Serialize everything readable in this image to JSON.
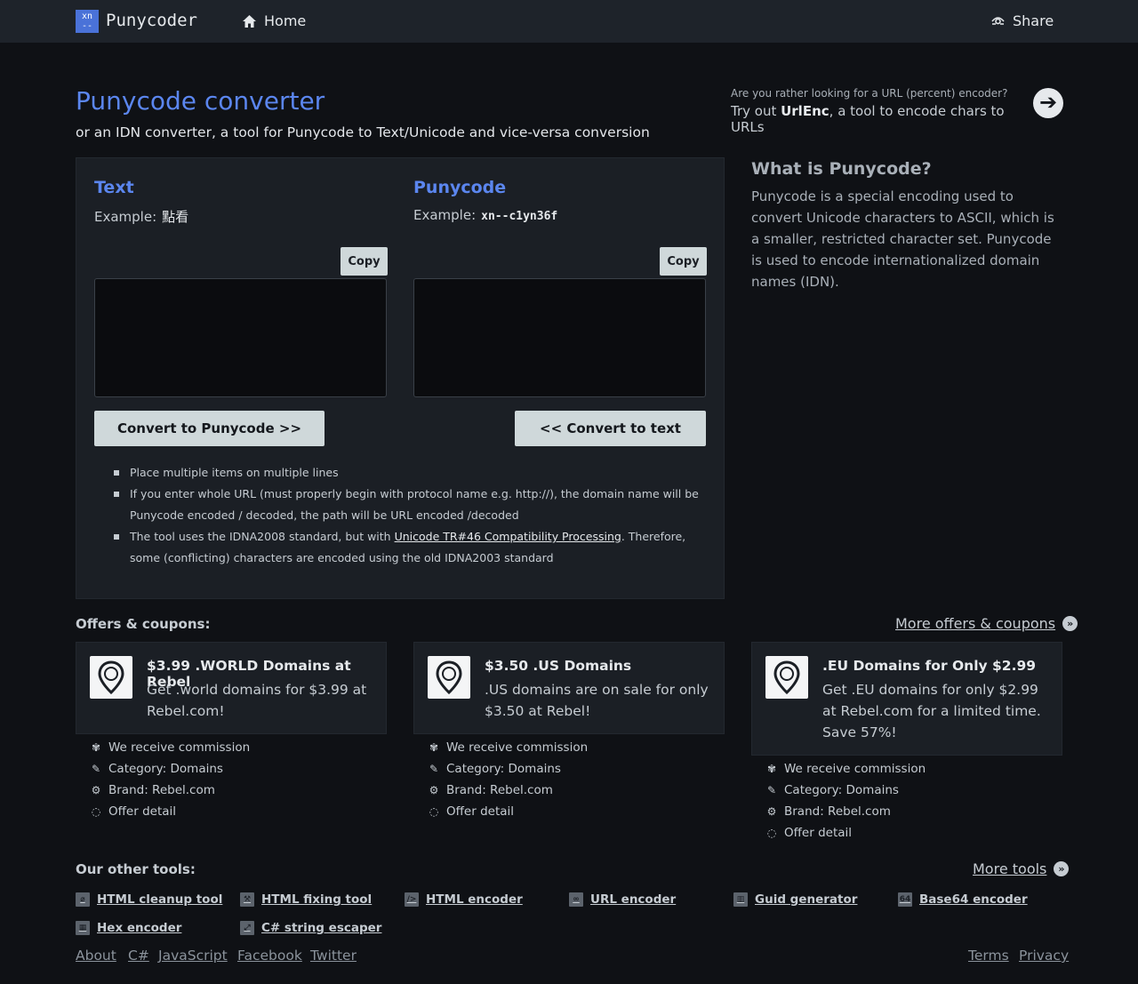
{
  "header": {
    "logo_mark": "xn\n--",
    "logo_text": "Punycoder",
    "home_label": "Home",
    "share_label": "Share"
  },
  "intro": {
    "title": "Punycode converter",
    "subtitle": "or an IDN converter, a tool for Punycode to Text/Unicode and vice-versa conversion",
    "alt_question": "Are you rather looking for a URL (percent) encoder?",
    "alt_prefix": "Try out ",
    "alt_tool": "UrlEnc",
    "alt_suffix": ", a tool to encode chars to URLs"
  },
  "converter": {
    "text_title": "Text",
    "text_example_label": "Example:",
    "text_example_value": "點看",
    "puny_title": "Punycode",
    "puny_example_label": "Example:",
    "puny_example_value": "xn--c1yn36f",
    "copy_label": "Copy",
    "text_value": "",
    "puny_value": "",
    "to_puny_label": "Convert to Punycode >>",
    "to_text_label": "<< Convert to text",
    "notes": [
      "Place multiple items on multiple lines",
      "If you enter whole URL (must properly begin with protocol name e.g. http://), the domain name will be Punycode encoded / decoded, the path will be URL encoded /decoded",
      "The tool uses the IDNA2008 standard, but with ",
      "Unicode TR#46 Compatibility Processing",
      ". Therefore, some (conflicting) characters are encoded using the old IDNA2003 standard"
    ]
  },
  "what_is": {
    "title": "What is Punycode?",
    "text": "Punycode is a special encoding used to convert Unicode characters to ASCII, which is a smaller, restricted character set. Punycode is used to encode internationalized domain names (IDN)."
  },
  "offers": {
    "heading": "Offers & coupons:",
    "more_label": "More offers & coupons",
    "items": [
      {
        "title": "$3.99 .WORLD Domains at Rebel",
        "desc": "Get .world domains for $3.99 at Rebel.com!",
        "commission": "We receive commission",
        "category": "Category: Domains",
        "brand": "Brand: Rebel.com",
        "detail": "Offer detail"
      },
      {
        "title": "$3.50 .US Domains",
        "desc": ".US domains are on sale for only $3.50 at Rebel!",
        "commission": "We receive commission",
        "category": "Category: Domains",
        "brand": "Brand: Rebel.com",
        "detail": "Offer detail"
      },
      {
        "title": ".EU Domains for Only $2.99",
        "desc": "Get .EU domains for only $2.99 at Rebel.com for a limited time. Save 57%!",
        "commission": "We receive commission",
        "category": "Category: Domains",
        "brand": "Brand: Rebel.com",
        "detail": "Offer detail"
      }
    ]
  },
  "tools": {
    "heading": "Our other tools:",
    "more_label": "More tools",
    "items": [
      {
        "label": "HTML cleanup tool",
        "icon": "broom-icon"
      },
      {
        "label": "HTML fixing tool",
        "icon": "wrench-icon"
      },
      {
        "label": "HTML encoder",
        "icon": "code-icon"
      },
      {
        "label": "URL encoder",
        "icon": "link-icon"
      },
      {
        "label": "Guid generator",
        "icon": "barcode-icon"
      },
      {
        "label": "Base64 encoder",
        "icon": "base64-icon"
      },
      {
        "label": "Hex encoder",
        "icon": "grid-icon"
      },
      {
        "label": "C# string escaper",
        "icon": "escape-icon"
      }
    ],
    "base64_glyph": "64"
  },
  "footer": {
    "links": [
      "About",
      "C#",
      "JavaScript",
      "Facebook",
      "Twitter"
    ],
    "terms": "Terms",
    "privacy": "Privacy"
  }
}
